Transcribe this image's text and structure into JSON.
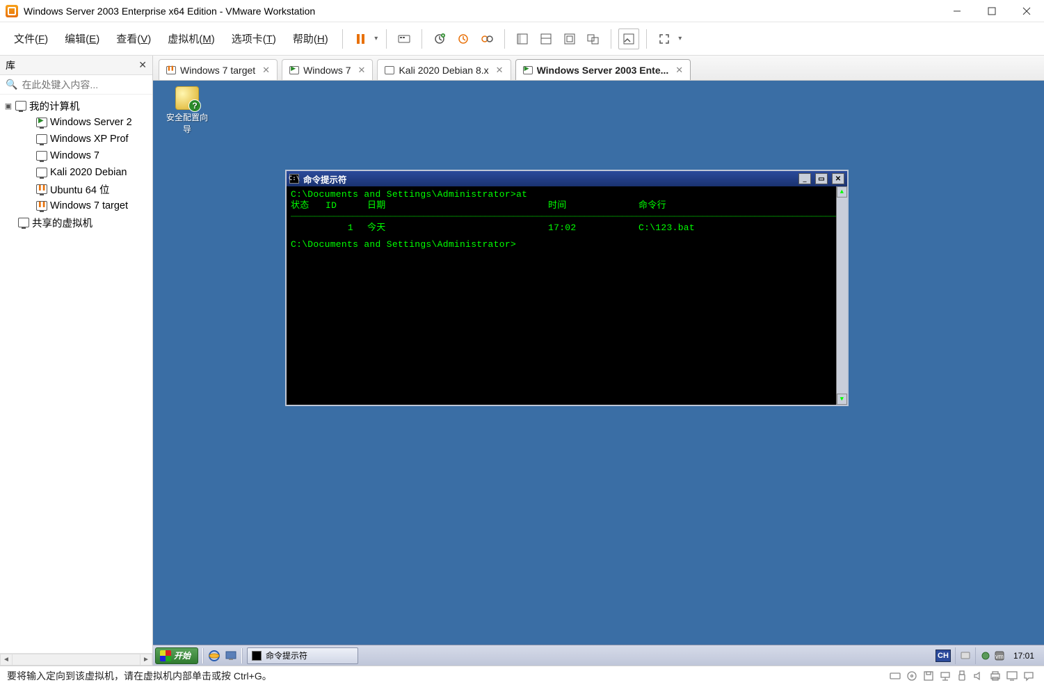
{
  "window": {
    "title": "Windows Server 2003 Enterprise x64 Edition - VMware Workstation"
  },
  "menubar": {
    "file": {
      "label": "文件(",
      "accel": "F",
      "tail": ")"
    },
    "edit": {
      "label": "编辑(",
      "accel": "E",
      "tail": ")"
    },
    "view": {
      "label": "查看(",
      "accel": "V",
      "tail": ")"
    },
    "vm": {
      "label": "虚拟机(",
      "accel": "M",
      "tail": ")"
    },
    "tabs": {
      "label": "选项卡(",
      "accel": "T",
      "tail": ")"
    },
    "help": {
      "label": "帮助(",
      "accel": "H",
      "tail": ")"
    }
  },
  "library": {
    "title": "库",
    "search_placeholder": "在此处键入内容...",
    "root": "我的计算机",
    "shared": "共享的虚拟机",
    "items": [
      {
        "label": "Windows Server 2",
        "state": "running"
      },
      {
        "label": "Windows XP Prof",
        "state": "off"
      },
      {
        "label": "Windows 7",
        "state": "off"
      },
      {
        "label": "Kali 2020 Debian",
        "state": "off"
      },
      {
        "label": "Ubuntu 64 位",
        "state": "paused"
      },
      {
        "label": "Windows 7 target",
        "state": "paused"
      }
    ]
  },
  "tabs": [
    {
      "label": "Windows 7 target",
      "state": "paused",
      "active": false
    },
    {
      "label": "Windows 7",
      "state": "running",
      "active": false
    },
    {
      "label": "Kali 2020 Debian 8.x",
      "state": "off",
      "active": false
    },
    {
      "label": "Windows Server 2003 Ente...",
      "state": "running",
      "active": true
    }
  ],
  "guest": {
    "desktop_icon_label": "安全配置向导",
    "cmd": {
      "title": "命令提示符",
      "prompt1": "C:\\Documents and Settings\\Administrator>",
      "command1": "at",
      "headers": {
        "status": "状态",
        "id": "ID",
        "date": "日期",
        "time": "时间",
        "cmdline": "命令行"
      },
      "row": {
        "status": "",
        "id": "1",
        "date": "今天",
        "time": "17:02",
        "cmdline": "C:\\123.bat"
      },
      "prompt2": "C:\\Documents and Settings\\Administrator>"
    },
    "taskbar": {
      "start": "开始",
      "task_cmd": "命令提示符",
      "lang": "CH",
      "clock": "17:01"
    }
  },
  "status": {
    "message": "要将输入定向到该虚拟机，请在虚拟机内部单击或按 Ctrl+G。"
  }
}
